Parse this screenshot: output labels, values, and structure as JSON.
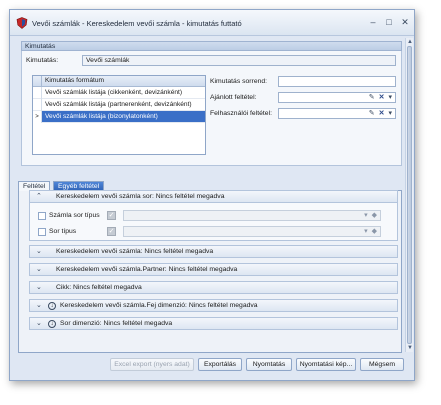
{
  "window": {
    "title": "Vevői számlák - Kereskedelem vevői számla - kimutatás futtató",
    "controls": {
      "minimize": "–",
      "maximize": "□",
      "close": "✕"
    }
  },
  "kimutatas_group": {
    "header": "Kimutatás",
    "name_label": "Kimutatás:",
    "name_value": "Vevői számlák",
    "format_list": {
      "header": "Kimutatás formátum",
      "items": [
        {
          "label": "Vevői számlák listája (cikkenként, devizánként)",
          "selected": false
        },
        {
          "label": "Vevői számlák listája (partnerenként, devizánként)",
          "selected": false
        },
        {
          "label": "Vevői számlák listája (bizonylatonként)",
          "selected": true
        }
      ],
      "selected_marker": ">"
    },
    "sort_label": "Kimutatás sorrend:",
    "sort_value": "",
    "offered_filter_label": "Ajánlott feltétel:",
    "offered_filter_value": "",
    "user_filter_label": "Felhasználói feltétel:",
    "user_filter_value": ""
  },
  "tabs": [
    {
      "label": "Feltétel",
      "active": true
    },
    {
      "label": "Egyéb feltétel",
      "active": false
    }
  ],
  "conditions": {
    "row_section": {
      "label": "Kereskedelem vevői számla sor: Nincs feltétel megadva",
      "chevron": "⌃",
      "items": [
        {
          "label": "Számla sor típus",
          "value": ""
        },
        {
          "label": "Sor típus",
          "value": ""
        }
      ]
    },
    "collapsed_sections": [
      {
        "label": "Kereskedelem vevői számla: Nincs feltétel megadva",
        "circle": false
      },
      {
        "label": "Kereskedelem vevői számla.Partner: Nincs feltétel megadva",
        "circle": false
      },
      {
        "label": "Cikk: Nincs feltétel megadva",
        "circle": false
      },
      {
        "label": "Kereskedelem vevői számla.Fej dimenzió: Nincs feltétel megadva",
        "circle": true
      },
      {
        "label": "Sor dimenzió: Nincs feltétel megadva",
        "circle": true
      }
    ],
    "chevron_down": "⌄"
  },
  "icons": {
    "pencil": "✎",
    "clear": "✕",
    "dropdown": "▾",
    "eraser": "◆",
    "down_circle": "↓"
  },
  "buttons": {
    "excel_export": "Excel export (nyers adat)",
    "export": "Exportálás",
    "print": "Nyomtatás",
    "print_preview": "Nyomtatási kép...",
    "cancel": "Mégsem"
  },
  "colors": {
    "accent": "#3a6fc7",
    "tab_active_bg": "#2f62b5",
    "window_bg": "#dfe7f3"
  }
}
